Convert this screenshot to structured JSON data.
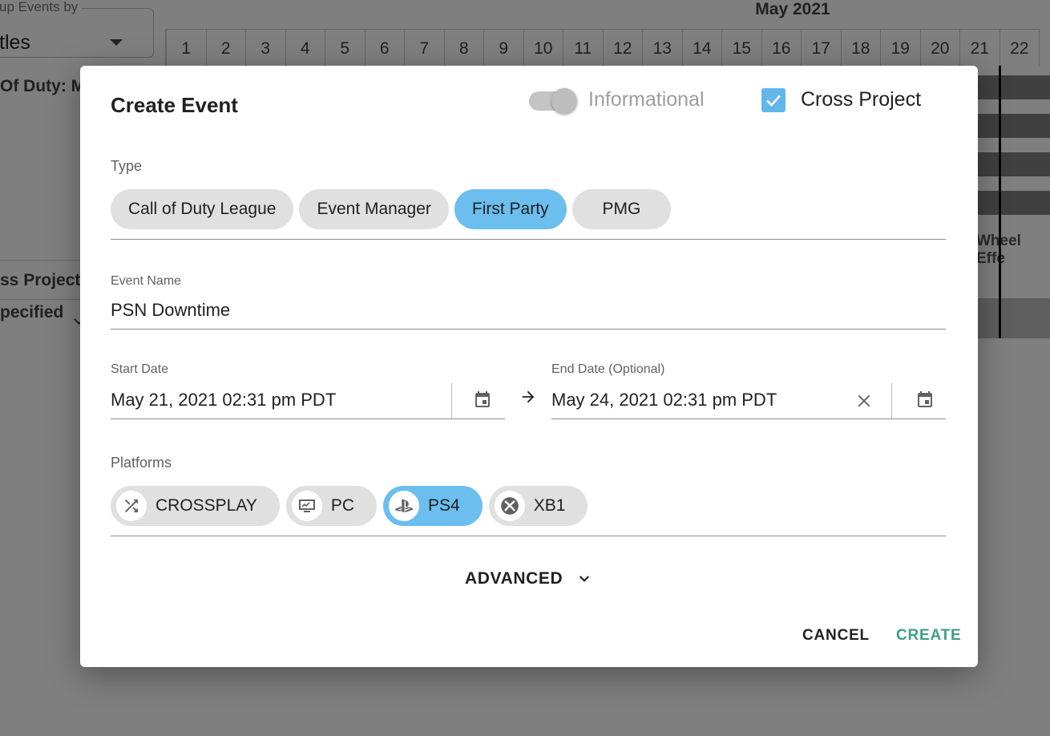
{
  "background": {
    "group_by_label": "up Events by",
    "group_by_value": "tles",
    "month": "May 2021",
    "days": [
      "1",
      "2",
      "3",
      "4",
      "5",
      "6",
      "7",
      "8",
      "9",
      "10",
      "11",
      "12",
      "13",
      "14",
      "15",
      "16",
      "17",
      "18",
      "19",
      "20",
      "21",
      "22"
    ],
    "row_title": "Of Duty: M",
    "cross_project_label": "ss Project",
    "unspecified_label": "pecified",
    "event_label": "Wheel Effe"
  },
  "dialog": {
    "title": "Create Event",
    "informational_label": "Informational",
    "informational_on": true,
    "cross_project_label": "Cross Project",
    "cross_project_checked": true,
    "type_label": "Type",
    "types": [
      {
        "label": "Call of Duty League",
        "selected": false
      },
      {
        "label": "Event Manager",
        "selected": false
      },
      {
        "label": "First Party",
        "selected": true
      },
      {
        "label": "PMG",
        "selected": false
      }
    ],
    "event_name_label": "Event Name",
    "event_name_value": "PSN Downtime",
    "start_date_label": "Start Date",
    "start_date_value": "May 21, 2021 02:31 pm PDT",
    "end_date_label": "End Date (Optional)",
    "end_date_value": "May 24, 2021 02:31 pm PDT",
    "platforms_label": "Platforms",
    "platforms": [
      {
        "label": "CROSSPLAY",
        "icon": "shuffle-icon",
        "selected": false
      },
      {
        "label": "PC",
        "icon": "monitor-icon",
        "selected": false
      },
      {
        "label": "PS4",
        "icon": "playstation-icon",
        "selected": true
      },
      {
        "label": "XB1",
        "icon": "xbox-icon",
        "selected": false
      }
    ],
    "advanced_label": "ADVANCED",
    "cancel_label": "CANCEL",
    "create_label": "CREATE"
  },
  "colors": {
    "chip_selected": "#6cbeee",
    "chip_default": "#e0e0e0",
    "checkbox": "#63b6ea",
    "create_button": "#3e9f82"
  }
}
